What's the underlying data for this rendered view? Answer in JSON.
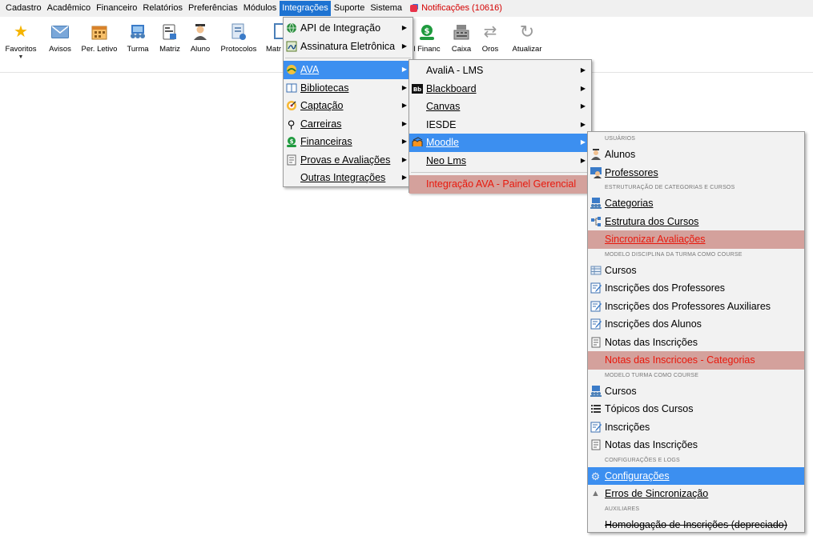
{
  "menubar": [
    {
      "label": "Cadastro",
      "active": false
    },
    {
      "label": "Acadêmico",
      "active": false
    },
    {
      "label": "Financeiro",
      "active": false
    },
    {
      "label": "Relatórios",
      "active": false
    },
    {
      "label": "Preferências",
      "active": false
    },
    {
      "label": "Módulos",
      "active": false
    },
    {
      "label": "Integrações",
      "active": true
    },
    {
      "label": "Suporte",
      "active": false
    },
    {
      "label": "Sistema",
      "active": false
    }
  ],
  "notifications": "Notificações (10616)",
  "toolbar": {
    "favoritos": "Favoritos",
    "avisos": "Avisos",
    "per_letivo": "Per. Letivo",
    "turma": "Turma",
    "matriz": "Matriz",
    "aluno": "Aluno",
    "protocolos": "Protocolos",
    "matr": "Matr",
    "financ": "l Financ",
    "caixa": "Caixa",
    "oros": "Oros",
    "atualizar": "Atualizar"
  },
  "menu_integracoes": [
    {
      "label": "API de Integração",
      "icon": "globe-icon"
    },
    {
      "label": "Assinatura Eletrônica",
      "icon": "signature-icon"
    },
    {
      "label": "AVA",
      "icon": "ava-icon"
    },
    {
      "label": "Bibliotecas",
      "icon": "book-icon"
    },
    {
      "label": "Captação",
      "icon": "target-icon"
    },
    {
      "label": "Carreiras",
      "icon": "career-icon"
    },
    {
      "label": "Financeiras",
      "icon": "money-icon"
    },
    {
      "label": "Provas e Avaliações",
      "icon": "exam-icon"
    },
    {
      "label": "Outras Integrações",
      "icon": ""
    }
  ],
  "menu_ava": [
    {
      "label": "AvaliA - LMS"
    },
    {
      "label": "Blackboard"
    },
    {
      "label": "Canvas"
    },
    {
      "label": "IESDE"
    },
    {
      "label": "Moodle"
    },
    {
      "label": "Neo Lms"
    },
    {
      "label": "Integração AVA - Painel Gerencial"
    }
  ],
  "menu_moodle": {
    "sec_usuarios": "USUÁRIOS",
    "alunos": "Alunos",
    "professores": "Professores",
    "sec_estruturacao": "ESTRUTURAÇÃO DE CATEGORIAS E CURSOS",
    "categorias": "Categorias",
    "estrutura_cursos": "Estrutura dos Cursos",
    "sincronizar_avaliacoes": "Sincronizar Avaliações",
    "sec_modelo_disciplina": "MODELO DISCIPLINA DA TURMA COMO COURSE",
    "cursos_1": "Cursos",
    "inscricoes_professores": "Inscrições dos Professores",
    "inscricoes_prof_aux": "Inscrições dos Professores Auxiliares",
    "inscricoes_alunos": "Inscrições dos Alunos",
    "notas_inscricoes_1": "Notas das Inscrições",
    "notas_inscricoes_categorias": "Notas das Inscricoes - Categorias",
    "sec_modelo_turma": "MODELO TURMA COMO COURSE",
    "cursos_2": "Cursos",
    "topicos_cursos": "Tópicos dos Cursos",
    "inscricoes": "Inscrições",
    "notas_inscricoes_2": "Notas das Inscrições",
    "sec_config": "CONFIGURAÇÕES E LOGS",
    "configuracoes": "Configurações",
    "erros_sincronizacao": "Erros de Sincronização",
    "sec_auxiliares": "AUXILIARES",
    "homologacao": "Homologação de Inscrições (depreciado)"
  }
}
